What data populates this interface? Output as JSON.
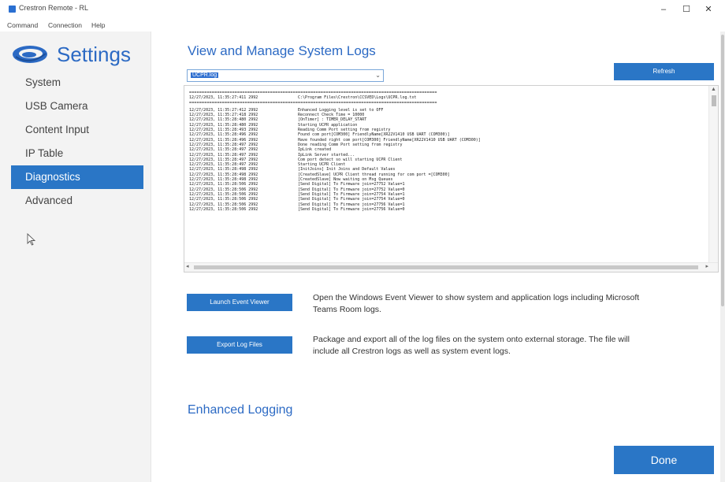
{
  "window": {
    "title": "Crestron Remote - RL",
    "controls": {
      "minimize": "–",
      "maximize": "☐",
      "close": "✕"
    },
    "brand_color": "#2a76c6"
  },
  "menu": [
    "Command",
    "Connection",
    "Help"
  ],
  "sidebar": {
    "logo_icon": "crestron-swirl-icon",
    "title": "Settings",
    "items": [
      {
        "label": "System",
        "active": false
      },
      {
        "label": "USB Camera",
        "active": false
      },
      {
        "label": "Content Input",
        "active": false
      },
      {
        "label": "IP Table",
        "active": false
      },
      {
        "label": "Diagnostics",
        "active": true
      },
      {
        "label": "Advanced",
        "active": false
      }
    ]
  },
  "main": {
    "heading": "View and Manage System Logs",
    "log_select": {
      "value": "UCPR.log"
    },
    "refresh_label": "Refresh",
    "log": {
      "separator": "==================================================================================================",
      "header": {
        "ts": "12/27/2023, 11:35:27:411 2992",
        "msg": "C:\\Program Files\\Crestron\\CCSVED\\Logs\\UCPR.log.txt"
      },
      "lines": [
        {
          "ts": "12/27/2023, 11:35:27:412 2992",
          "msg": "Enhanced Logging level is set to OFF"
        },
        {
          "ts": "12/27/2023, 11:35:27:418 2992",
          "msg": "Reconnect Check Time = 10000"
        },
        {
          "ts": "12/27/2023, 11:35:28:480 2992",
          "msg": "[OnTimer] : TIMER_DELAY_START"
        },
        {
          "ts": "12/27/2023, 11:35:28:480 2992",
          "msg": "Starting UCPR application"
        },
        {
          "ts": "12/27/2023, 11:35:28:493 2992",
          "msg": "Reading Comm Port setting from registry"
        },
        {
          "ts": "12/27/2023, 11:35:28:496 2992",
          "msg": "Found com port[COM300]  FriendlyName[XR22V1410 USB UART (COM300)]"
        },
        {
          "ts": "12/27/2023, 11:35:28:496 2992",
          "msg": "Have founded right com port[COM300]  FriendlyName[XR22V1410 USB UART (COM300)]"
        },
        {
          "ts": "12/27/2023, 11:35:28:497 2992",
          "msg": "Done reading Comm Port setting from registry"
        },
        {
          "ts": "12/27/2023, 11:35:28:497 2992",
          "msg": "IpLink created"
        },
        {
          "ts": "12/27/2023, 11:35:28:497 2992",
          "msg": "IpLink Server started..."
        },
        {
          "ts": "12/27/2023, 11:35:28:497 2992",
          "msg": "Com port detect so will starting UCPR Client"
        },
        {
          "ts": "12/27/2023, 11:35:28:497 2992",
          "msg": "Starting UCPR Client"
        },
        {
          "ts": "12/27/2023, 11:35:28:498 2992",
          "msg": "[InitJoins] Init Joins and Default Values"
        },
        {
          "ts": "12/27/2023, 11:35:28:498 2992",
          "msg": "[CreatedSlave] UCPR Client thread running for com port =[COM300]"
        },
        {
          "ts": "12/27/2023, 11:35:28:498 2992",
          "msg": "[CreatedSlave] Now waiting on Msg Queues"
        },
        {
          "ts": "12/27/2023, 11:35:28:506 2992",
          "msg": "[Send Digital] To Firmware join=27752 Value=1"
        },
        {
          "ts": "12/27/2023, 11:35:28:506 2992",
          "msg": "[Send Digital] To Firmware join=27752 Value=0"
        },
        {
          "ts": "12/27/2023, 11:35:28:506 2992",
          "msg": "[Send Digital] To Firmware join=27754 Value=1"
        },
        {
          "ts": "12/27/2023, 11:35:28:506 2992",
          "msg": "[Send Digital] To Firmware join=27754 Value=0"
        },
        {
          "ts": "12/27/2023, 11:35:28:506 2992",
          "msg": "[Send Digital] To Firmware join=27756 Value=1"
        },
        {
          "ts": "12/27/2023, 11:35:28:506 2992",
          "msg": "[Send Digital] To Firmware join=27756 Value=0"
        }
      ]
    },
    "launch_label": "Launch Event Viewer",
    "launch_desc": "Open the Windows Event Viewer to show system and application logs including Microsoft Teams Room logs.",
    "export_label": "Export Log Files",
    "export_desc": "Package and export all of the log files on the system onto external storage.  The file will include all Crestron logs as well as system event logs.",
    "enhanced_heading": "Enhanced Logging",
    "done_label": "Done"
  }
}
